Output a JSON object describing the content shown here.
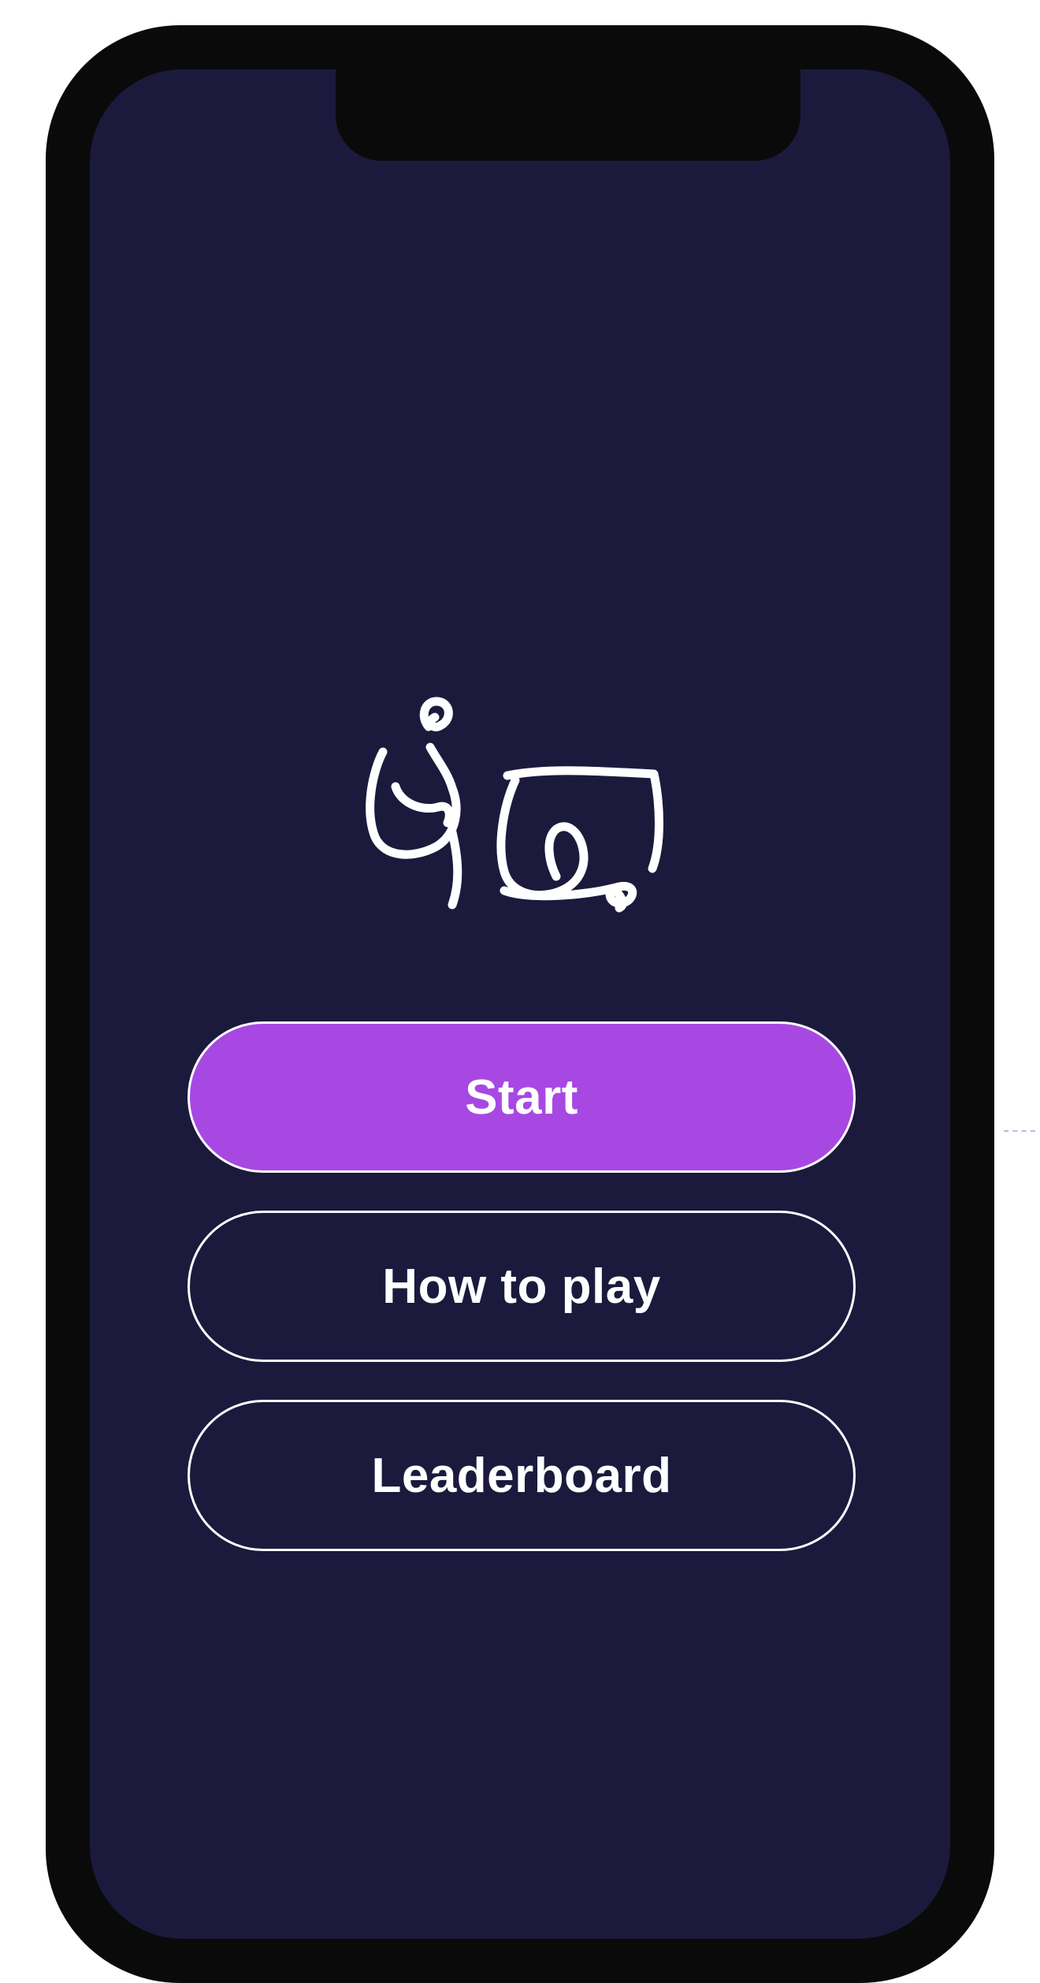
{
  "app": {
    "logo": {
      "text": "ជំនាញ",
      "icon": "khmer-script-logo"
    }
  },
  "menu": {
    "start_label": "Start",
    "how_to_play_label": "How to play",
    "leaderboard_label": "Leaderboard"
  },
  "colors": {
    "frame": "#0a0a0a",
    "screen_background": "#1b1a3d",
    "primary_button": "#a748e3",
    "button_border": "#ffffff",
    "text": "#ffffff"
  }
}
